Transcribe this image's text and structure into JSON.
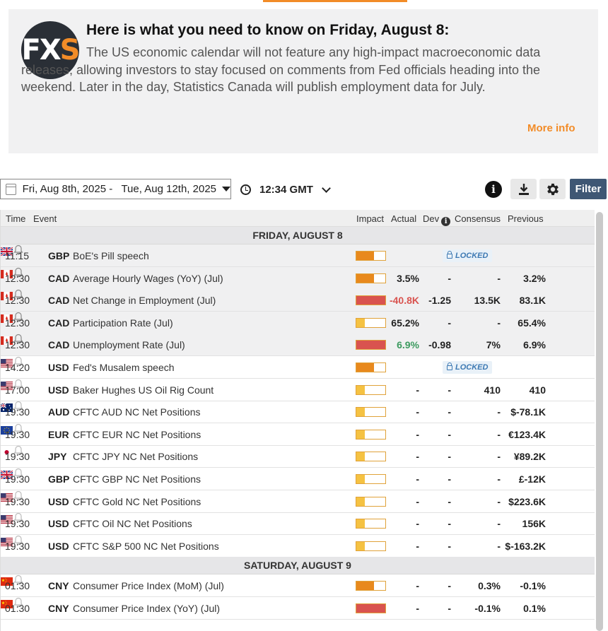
{
  "news": {
    "logo_left": "FX",
    "logo_right": "S",
    "title": "Here is what you need to know on Friday, August 8:",
    "body": "The US economic calendar will not feature any high-impact macroeconomic data releases, allowing investors to stay focused on comments from Fed officials heading into the weekend. Later in the day, Statistics Canada will publish employment data for July.",
    "more_info": "More info"
  },
  "toolbar": {
    "date_range": "Fri, Aug 8th, 2025 -   Tue, Aug 12th, 2025",
    "time": "12:34 GMT",
    "info_label": "i",
    "filter_label": "Filter"
  },
  "columns": {
    "time": "Time",
    "event": "Event",
    "impact": "Impact",
    "actual": "Actual",
    "dev": "Dev",
    "dev_info": "i",
    "consensus": "Consensus",
    "previous": "Previous"
  },
  "colors": {
    "accent": "#f28c28",
    "filter_button": "#3f5774",
    "impact_high": "#d9534f",
    "impact_medium": "#e8891d",
    "impact_low": "#f5c242",
    "negative": "#d9534f",
    "positive": "#3c9a5f"
  },
  "days": [
    {
      "label": "FRIDAY, AUGUST 8",
      "events": [
        {
          "time": "11:15",
          "flag": "gb",
          "currency": "GBP",
          "event": "BoE's Pill speech",
          "impact": "medium",
          "locked": true,
          "locked_label": "LOCKED",
          "past": true
        },
        {
          "time": "12:30",
          "flag": "ca",
          "currency": "CAD",
          "event": "Average Hourly Wages (YoY) (Jul)",
          "impact": "medium",
          "actual": "3.5%",
          "actual_tone": "",
          "dev": "-",
          "consensus": "-",
          "previous": "3.2%",
          "past": true
        },
        {
          "time": "12:30",
          "flag": "ca",
          "currency": "CAD",
          "event": "Net Change in Employment (Jul)",
          "impact": "high",
          "actual": "-40.8K",
          "actual_tone": "neg",
          "dev": "-1.25",
          "consensus": "13.5K",
          "previous": "83.1K",
          "past": true
        },
        {
          "time": "12:30",
          "flag": "ca",
          "currency": "CAD",
          "event": "Participation Rate (Jul)",
          "impact": "low",
          "actual": "65.2%",
          "actual_tone": "",
          "dev": "-",
          "consensus": "-",
          "previous": "65.4%",
          "past": true
        },
        {
          "time": "12:30",
          "flag": "ca",
          "currency": "CAD",
          "event": "Unemployment Rate (Jul)",
          "impact": "high",
          "actual": "6.9%",
          "actual_tone": "pos",
          "dev": "-0.98",
          "consensus": "7%",
          "previous": "6.9%",
          "past": true
        },
        {
          "time": "14:20",
          "flag": "us",
          "currency": "USD",
          "event": "Fed's Musalem speech",
          "impact": "medium",
          "locked": true,
          "locked_label": "LOCKED",
          "past": false
        },
        {
          "time": "17:00",
          "flag": "us",
          "currency": "USD",
          "event": "Baker Hughes US Oil Rig Count",
          "impact": "low",
          "actual": "-",
          "actual_tone": "",
          "dev": "-",
          "consensus": "410",
          "previous": "410",
          "past": false
        },
        {
          "time": "19:30",
          "flag": "au",
          "currency": "AUD",
          "event": "CFTC AUD NC Net Positions",
          "impact": "low",
          "actual": "-",
          "actual_tone": "",
          "dev": "-",
          "consensus": "-",
          "previous": "$-78.1K",
          "past": false
        },
        {
          "time": "19:30",
          "flag": "eu",
          "currency": "EUR",
          "event": "CFTC EUR NC Net Positions",
          "impact": "low",
          "actual": "-",
          "actual_tone": "",
          "dev": "-",
          "consensus": "-",
          "previous": "€123.4K",
          "past": false
        },
        {
          "time": "19:30",
          "flag": "jp",
          "currency": "JPY",
          "event": "CFTC JPY NC Net Positions",
          "impact": "low",
          "actual": "-",
          "actual_tone": "",
          "dev": "-",
          "consensus": "-",
          "previous": "¥89.2K",
          "past": false
        },
        {
          "time": "19:30",
          "flag": "gb",
          "currency": "GBP",
          "event": "CFTC GBP NC Net Positions",
          "impact": "low",
          "actual": "-",
          "actual_tone": "",
          "dev": "-",
          "consensus": "-",
          "previous": "£-12K",
          "past": false
        },
        {
          "time": "19:30",
          "flag": "us",
          "currency": "USD",
          "event": "CFTC Gold NC Net Positions",
          "impact": "low",
          "actual": "-",
          "actual_tone": "",
          "dev": "-",
          "consensus": "-",
          "previous": "$223.6K",
          "past": false
        },
        {
          "time": "19:30",
          "flag": "us",
          "currency": "USD",
          "event": "CFTC Oil NC Net Positions",
          "impact": "low",
          "actual": "-",
          "actual_tone": "",
          "dev": "-",
          "consensus": "-",
          "previous": "156K",
          "past": false
        },
        {
          "time": "19:30",
          "flag": "us",
          "currency": "USD",
          "event": "CFTC S&P 500 NC Net Positions",
          "impact": "low",
          "actual": "-",
          "actual_tone": "",
          "dev": "-",
          "consensus": "-",
          "previous": "$-163.2K",
          "past": false
        }
      ]
    },
    {
      "label": "SATURDAY, AUGUST 9",
      "events": [
        {
          "time": "01:30",
          "flag": "cn",
          "currency": "CNY",
          "event": "Consumer Price Index (MoM) (Jul)",
          "impact": "medium",
          "actual": "-",
          "actual_tone": "",
          "dev": "-",
          "consensus": "0.3%",
          "previous": "-0.1%",
          "past": false
        },
        {
          "time": "01:30",
          "flag": "cn",
          "currency": "CNY",
          "event": "Consumer Price Index (YoY) (Jul)",
          "impact": "high",
          "actual": "-",
          "actual_tone": "",
          "dev": "-",
          "consensus": "-0.1%",
          "previous": "0.1%",
          "past": false
        }
      ]
    }
  ]
}
